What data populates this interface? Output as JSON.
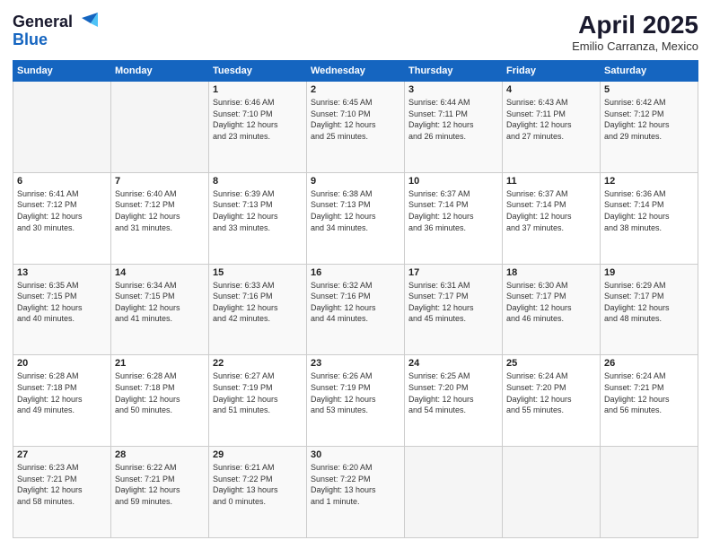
{
  "header": {
    "logo_line1": "General",
    "logo_line2": "Blue",
    "title": "April 2025",
    "subtitle": "Emilio Carranza, Mexico"
  },
  "calendar": {
    "days_of_week": [
      "Sunday",
      "Monday",
      "Tuesday",
      "Wednesday",
      "Thursday",
      "Friday",
      "Saturday"
    ],
    "weeks": [
      [
        {
          "day": "",
          "info": ""
        },
        {
          "day": "",
          "info": ""
        },
        {
          "day": "1",
          "info": "Sunrise: 6:46 AM\nSunset: 7:10 PM\nDaylight: 12 hours\nand 23 minutes."
        },
        {
          "day": "2",
          "info": "Sunrise: 6:45 AM\nSunset: 7:10 PM\nDaylight: 12 hours\nand 25 minutes."
        },
        {
          "day": "3",
          "info": "Sunrise: 6:44 AM\nSunset: 7:11 PM\nDaylight: 12 hours\nand 26 minutes."
        },
        {
          "day": "4",
          "info": "Sunrise: 6:43 AM\nSunset: 7:11 PM\nDaylight: 12 hours\nand 27 minutes."
        },
        {
          "day": "5",
          "info": "Sunrise: 6:42 AM\nSunset: 7:12 PM\nDaylight: 12 hours\nand 29 minutes."
        }
      ],
      [
        {
          "day": "6",
          "info": "Sunrise: 6:41 AM\nSunset: 7:12 PM\nDaylight: 12 hours\nand 30 minutes."
        },
        {
          "day": "7",
          "info": "Sunrise: 6:40 AM\nSunset: 7:12 PM\nDaylight: 12 hours\nand 31 minutes."
        },
        {
          "day": "8",
          "info": "Sunrise: 6:39 AM\nSunset: 7:13 PM\nDaylight: 12 hours\nand 33 minutes."
        },
        {
          "day": "9",
          "info": "Sunrise: 6:38 AM\nSunset: 7:13 PM\nDaylight: 12 hours\nand 34 minutes."
        },
        {
          "day": "10",
          "info": "Sunrise: 6:37 AM\nSunset: 7:14 PM\nDaylight: 12 hours\nand 36 minutes."
        },
        {
          "day": "11",
          "info": "Sunrise: 6:37 AM\nSunset: 7:14 PM\nDaylight: 12 hours\nand 37 minutes."
        },
        {
          "day": "12",
          "info": "Sunrise: 6:36 AM\nSunset: 7:14 PM\nDaylight: 12 hours\nand 38 minutes."
        }
      ],
      [
        {
          "day": "13",
          "info": "Sunrise: 6:35 AM\nSunset: 7:15 PM\nDaylight: 12 hours\nand 40 minutes."
        },
        {
          "day": "14",
          "info": "Sunrise: 6:34 AM\nSunset: 7:15 PM\nDaylight: 12 hours\nand 41 minutes."
        },
        {
          "day": "15",
          "info": "Sunrise: 6:33 AM\nSunset: 7:16 PM\nDaylight: 12 hours\nand 42 minutes."
        },
        {
          "day": "16",
          "info": "Sunrise: 6:32 AM\nSunset: 7:16 PM\nDaylight: 12 hours\nand 44 minutes."
        },
        {
          "day": "17",
          "info": "Sunrise: 6:31 AM\nSunset: 7:17 PM\nDaylight: 12 hours\nand 45 minutes."
        },
        {
          "day": "18",
          "info": "Sunrise: 6:30 AM\nSunset: 7:17 PM\nDaylight: 12 hours\nand 46 minutes."
        },
        {
          "day": "19",
          "info": "Sunrise: 6:29 AM\nSunset: 7:17 PM\nDaylight: 12 hours\nand 48 minutes."
        }
      ],
      [
        {
          "day": "20",
          "info": "Sunrise: 6:28 AM\nSunset: 7:18 PM\nDaylight: 12 hours\nand 49 minutes."
        },
        {
          "day": "21",
          "info": "Sunrise: 6:28 AM\nSunset: 7:18 PM\nDaylight: 12 hours\nand 50 minutes."
        },
        {
          "day": "22",
          "info": "Sunrise: 6:27 AM\nSunset: 7:19 PM\nDaylight: 12 hours\nand 51 minutes."
        },
        {
          "day": "23",
          "info": "Sunrise: 6:26 AM\nSunset: 7:19 PM\nDaylight: 12 hours\nand 53 minutes."
        },
        {
          "day": "24",
          "info": "Sunrise: 6:25 AM\nSunset: 7:20 PM\nDaylight: 12 hours\nand 54 minutes."
        },
        {
          "day": "25",
          "info": "Sunrise: 6:24 AM\nSunset: 7:20 PM\nDaylight: 12 hours\nand 55 minutes."
        },
        {
          "day": "26",
          "info": "Sunrise: 6:24 AM\nSunset: 7:21 PM\nDaylight: 12 hours\nand 56 minutes."
        }
      ],
      [
        {
          "day": "27",
          "info": "Sunrise: 6:23 AM\nSunset: 7:21 PM\nDaylight: 12 hours\nand 58 minutes."
        },
        {
          "day": "28",
          "info": "Sunrise: 6:22 AM\nSunset: 7:21 PM\nDaylight: 12 hours\nand 59 minutes."
        },
        {
          "day": "29",
          "info": "Sunrise: 6:21 AM\nSunset: 7:22 PM\nDaylight: 13 hours\nand 0 minutes."
        },
        {
          "day": "30",
          "info": "Sunrise: 6:20 AM\nSunset: 7:22 PM\nDaylight: 13 hours\nand 1 minute."
        },
        {
          "day": "",
          "info": ""
        },
        {
          "day": "",
          "info": ""
        },
        {
          "day": "",
          "info": ""
        }
      ]
    ]
  }
}
